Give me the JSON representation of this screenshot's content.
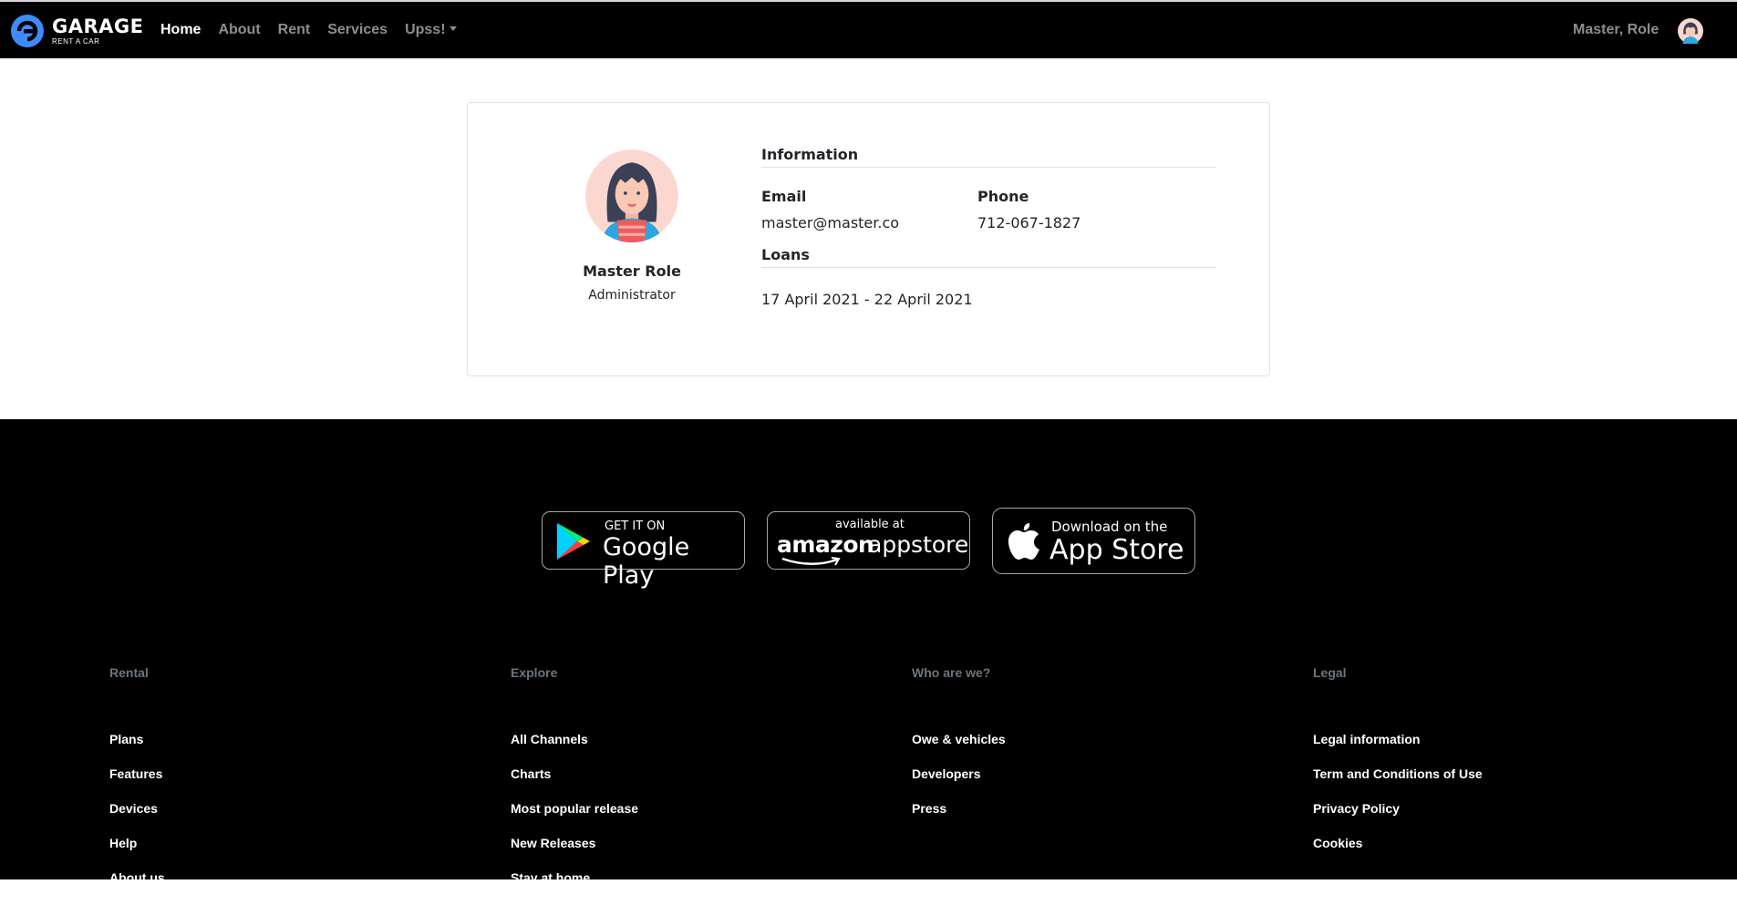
{
  "nav": {
    "brand_name": "GARAGE",
    "brand_tagline": "RENT A CAR",
    "links": [
      {
        "label": "Home",
        "active": true
      },
      {
        "label": "About",
        "active": false
      },
      {
        "label": "Rent",
        "active": false
      },
      {
        "label": "Services",
        "active": false
      },
      {
        "label": "Upss!",
        "active": false,
        "dropdown": true
      }
    ],
    "user_name": "Master, Role",
    "user_avatar_icon": "avatar-woman-icon"
  },
  "profile": {
    "name": "Master Role",
    "role": "Administrator",
    "avatar_icon": "avatar-woman-icon",
    "information_title": "Information",
    "email_label": "Email",
    "email_value": "master@master.co",
    "phone_label": "Phone",
    "phone_value": "712-067-1827",
    "loans_title": "Loans",
    "loans": [
      "17 April 2021 - 22 April 2021"
    ]
  },
  "stores": {
    "google": {
      "small": "GET IT ON",
      "big": "Google Play",
      "icon": "google-play-icon"
    },
    "amazon": {
      "small": "available at",
      "big_left": "amazon",
      "big_right": "appstore",
      "icon": "amazon-smile-icon"
    },
    "apple": {
      "small": "Download on the",
      "big": "App Store",
      "icon": "apple-icon"
    }
  },
  "footer": {
    "columns": [
      {
        "heading": "Rental",
        "items": [
          "Plans",
          "Features",
          "Devices",
          "Help",
          "About us"
        ]
      },
      {
        "heading": "Explore",
        "items": [
          "All Channels",
          "Charts",
          "Most popular release",
          "New Releases",
          "Stay at home"
        ]
      },
      {
        "heading": "Who are we?",
        "items": [
          "Owe & vehicles",
          "Developers",
          "Press"
        ]
      },
      {
        "heading": "Legal",
        "items": [
          "Legal information",
          "Term and Conditions of Use",
          "Privacy Policy",
          "Cookies"
        ]
      }
    ]
  },
  "colors": {
    "nav_bg": "#000000",
    "brand_logo": "#3d8bfd",
    "footer_bg": "#000000",
    "card_border": "#dee2e6"
  }
}
